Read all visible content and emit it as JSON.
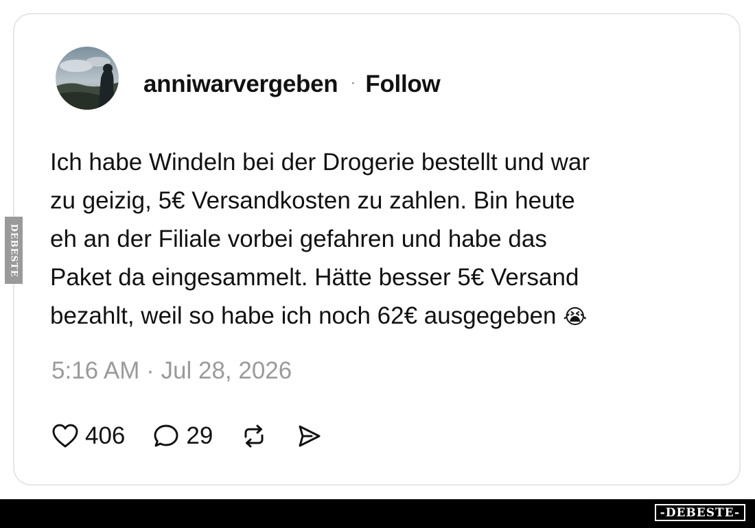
{
  "post": {
    "username": "anniwarvergeben",
    "separator": "·",
    "follow_label": "Follow",
    "text_lines": [
      "Ich habe Windeln bei der Drogerie bestellt und war",
      "zu geizig, 5€ Versandkosten zu zahlen. Bin heute",
      "eh an der Filiale vorbei gefahren und habe das",
      "Paket da eingesammelt. Hätte besser 5€ Versand",
      "bezahlt, weil so habe ich noch 62€ ausgegeben"
    ],
    "emoji": "😭",
    "timestamp": "5:16 AM · Jul 28, 2026"
  },
  "actions": {
    "like_icon": "heart-icon",
    "like_count": "406",
    "comment_icon": "speech-bubble-icon",
    "comment_count": "29",
    "repost_icon": "repost-icon",
    "share_icon": "share-send-icon"
  },
  "watermark": {
    "side_text": "DEBESTE",
    "logo_text": "-DEBESTE-"
  },
  "colors": {
    "text": "#111111",
    "muted": "#9a9a9a",
    "card_border": "#e6e6e6",
    "footer": "#000000"
  }
}
